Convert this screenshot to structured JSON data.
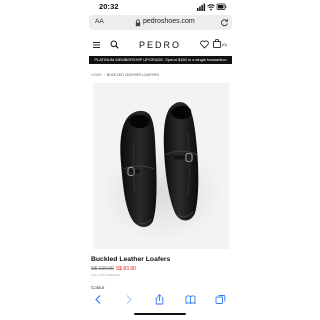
{
  "status_bar": {
    "time": "20:32",
    "icons": [
      "signal-icon",
      "wifi-icon",
      "battery-icon"
    ]
  },
  "browser": {
    "text_size_label": "AA",
    "url": "pedroshoes.com",
    "toolbar_icons": [
      "back-icon",
      "forward-icon",
      "share-icon",
      "bookmarks-icon",
      "tabs-icon"
    ],
    "accent_color": "#2f7bf6"
  },
  "site": {
    "brand": "PEDRO",
    "bag_count": "(0)",
    "promo_text": "PLATINUM MEMBERSHIP UPGRADE: Spend $180 in a single transaction"
  },
  "breadcrumb": {
    "home": "HOME",
    "separator": "/",
    "current": "BUCKLED LEATHER LOAFERS"
  },
  "product": {
    "title": "Buckled Leather Loafers",
    "original_price": "S$ 139.90",
    "sale_price": "S$ 83.90",
    "style_number": "Style: PM1-46600065",
    "colour_label": "Colour",
    "sale_color": "#e02020"
  }
}
